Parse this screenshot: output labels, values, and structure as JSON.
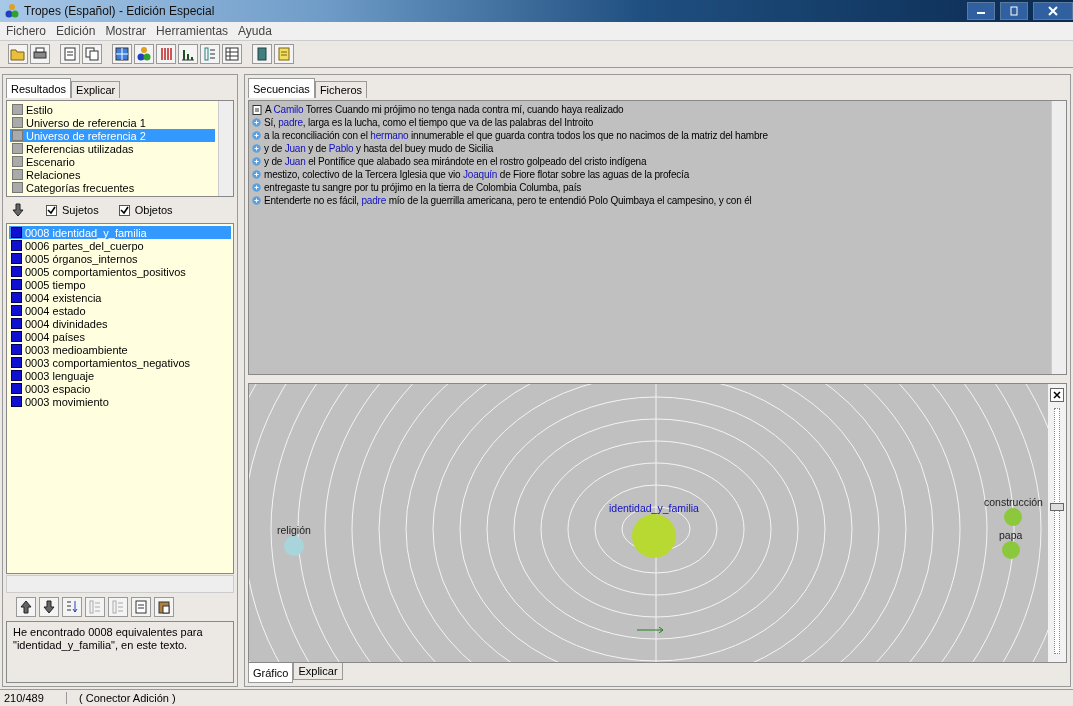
{
  "window": {
    "title": "Tropes (Español) - Edición Especial"
  },
  "menu": [
    "Fichero",
    "Edición",
    "Mostrar",
    "Herramientas",
    "Ayuda"
  ],
  "left_tabs": [
    {
      "label": "Resultados",
      "selected": true
    },
    {
      "label": "Explicar",
      "selected": false
    }
  ],
  "categories": [
    {
      "label": "Estilo",
      "selected": false
    },
    {
      "label": "Universo de referencia 1",
      "selected": false
    },
    {
      "label": "Universo de referencia 2",
      "selected": true
    },
    {
      "label": "Referencias utilizadas",
      "selected": false
    },
    {
      "label": "Escenario",
      "selected": false
    },
    {
      "label": "Relaciones",
      "selected": false
    },
    {
      "label": "Categorías frecuentes",
      "selected": false
    }
  ],
  "filters": [
    {
      "label": "Sujetos",
      "checked": true
    },
    {
      "label": "Objetos",
      "checked": true
    }
  ],
  "results": [
    {
      "label": "0008 identidad_y_familia",
      "selected": true
    },
    {
      "label": "0006 partes_del_cuerpo",
      "selected": false
    },
    {
      "label": "0005 órganos_internos",
      "selected": false
    },
    {
      "label": "0005 comportamientos_positivos",
      "selected": false
    },
    {
      "label": "0005 tiempo",
      "selected": false
    },
    {
      "label": "0004 existencia",
      "selected": false
    },
    {
      "label": "0004 estado",
      "selected": false
    },
    {
      "label": "0004 divinidades",
      "selected": false
    },
    {
      "label": "0004 países",
      "selected": false
    },
    {
      "label": "0003 medioambiente",
      "selected": false
    },
    {
      "label": "0003 comportamientos_negativos",
      "selected": false
    },
    {
      "label": "0003 lenguaje",
      "selected": false
    },
    {
      "label": "0003 espacio",
      "selected": false
    },
    {
      "label": "0003 movimiento",
      "selected": false
    }
  ],
  "message": "He encontrado 0008 equivalentes para \"identidad_y_familia\", en este texto.",
  "right_tabs": [
    {
      "label": "Secuencias",
      "selected": true
    },
    {
      "label": "Ficheros",
      "selected": false
    }
  ],
  "sentences": [
    {
      "kind": "document",
      "parts": [
        {
          "text": "A ",
          "highlight": false
        },
        {
          "text": "Camilo",
          "highlight": true
        },
        {
          "text": " Torres Cuando mi prójimo no tenga nada contra mí, cuando haya realizado",
          "highlight": false
        }
      ]
    },
    {
      "kind": "bullet",
      "parts": [
        {
          "text": "Sí, ",
          "highlight": false
        },
        {
          "text": "padre",
          "highlight": true
        },
        {
          "text": ", larga es la lucha, como el tiempo que va de las palabras del Introito",
          "highlight": false
        }
      ]
    },
    {
      "kind": "bullet",
      "parts": [
        {
          "text": "a la reconciliación con el ",
          "highlight": false
        },
        {
          "text": "hermano",
          "highlight": true
        },
        {
          "text": " innumerable el que guarda contra todos los que no nacimos de la matriz del hambre",
          "highlight": false
        }
      ]
    },
    {
      "kind": "bullet",
      "parts": [
        {
          "text": "y de ",
          "highlight": false
        },
        {
          "text": "Juan",
          "highlight": true
        },
        {
          "text": " y de ",
          "highlight": false
        },
        {
          "text": "Pablo",
          "highlight": true
        },
        {
          "text": " y hasta del buey mudo de Sicilia",
          "highlight": false
        }
      ]
    },
    {
      "kind": "bullet",
      "parts": [
        {
          "text": "y de ",
          "highlight": false
        },
        {
          "text": "Juan",
          "highlight": true
        },
        {
          "text": " el Pontífice que alabado sea mirándote en el rostro golpeado del cristo indígena",
          "highlight": false
        }
      ]
    },
    {
      "kind": "bullet",
      "parts": [
        {
          "text": "mestizo, colectivo de la Tercera Iglesia que vio ",
          "highlight": false
        },
        {
          "text": "Joaquín",
          "highlight": true
        },
        {
          "text": " de Fiore flotar sobre las aguas de la profecía",
          "highlight": false
        }
      ]
    },
    {
      "kind": "bullet",
      "parts": [
        {
          "text": "entregaste tu sangre por tu prójimo en la tierra de Colombia Columba, país",
          "highlight": false
        }
      ]
    },
    {
      "kind": "bullet",
      "parts": [
        {
          "text": "Entenderte no es fácil, ",
          "highlight": false
        },
        {
          "text": "padre",
          "highlight": true
        },
        {
          "text": " mío de la guerrilla americana, pero te entendió Polo Quimbaya el campesino, y con él",
          "highlight": false
        }
      ]
    }
  ],
  "graph": {
    "nodes": [
      {
        "kind": "center",
        "label": "identidad_y_familia",
        "color": "#b8d832"
      },
      {
        "kind": "left",
        "label": "religión",
        "color": "#a8d4dc"
      },
      {
        "kind": "right",
        "label": "construcción",
        "color": "#8cc83c"
      },
      {
        "kind": "right",
        "label": "papa",
        "color": "#8cc83c"
      }
    ],
    "zoom": {
      "level": 0.58
    }
  },
  "bottom_tabs": [
    {
      "label": "Gráfico",
      "selected": true
    },
    {
      "label": "Explicar",
      "selected": false
    }
  ],
  "status_bar": [
    "210/489",
    "( Conector Adición )"
  ]
}
